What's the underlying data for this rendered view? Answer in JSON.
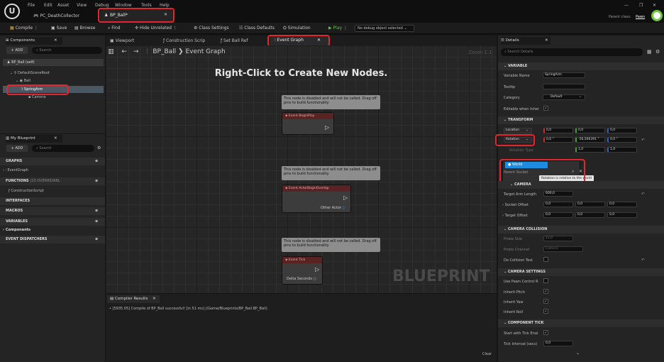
{
  "menu": [
    "File",
    "Edit",
    "Asset",
    "View",
    "Debug",
    "Window",
    "Tools",
    "Help"
  ],
  "project_name": "PC_DeathCollector",
  "doc_tab": "BP_Ball*",
  "parent_class_label": "Parent class:",
  "parent_class_value": "Pawn",
  "toolbar": {
    "compile": "Compile",
    "save": "Save",
    "browse": "Browse",
    "find": "Find",
    "hide_unrelated": "Hide Unrelated",
    "class_settings": "Class Settings",
    "class_defaults": "Class Defaults",
    "simulation": "Simulation",
    "play": "Play",
    "debug_object": "No debug object selected"
  },
  "components": {
    "title": "Components",
    "add": "+ ADD",
    "search_placeholder": "Search",
    "self": "BP_Ball (self)",
    "root": "DefaultSceneRoot",
    "ball": "Ball",
    "spring": "SpringArm",
    "camera": "Camera"
  },
  "my_blueprint": {
    "title": "My Blueprint",
    "add": "+ ADD",
    "search_placeholder": "Search",
    "graphs": "GRAPHS",
    "event_graph": "EventGraph",
    "functions": "FUNCTIONS",
    "functions_count": "(23 OVERRIDABL",
    "construction": "ConstructionScript",
    "interfaces": "INTERFACES",
    "macros": "MACROS",
    "variables": "VARIABLES",
    "components": "Components",
    "dispatchers": "EVENT DISPATCHERS"
  },
  "graph_tabs": {
    "viewport": "Viewport",
    "construction": "Construction Scrip",
    "set_ball_ref": "Set Ball Ref",
    "event_graph": "Event Graph"
  },
  "breadcrumb": {
    "bp": "BP_Ball",
    "graph": "Event Graph",
    "zoom": "Zoom 1:1"
  },
  "graph_hint": "Right-Click to Create New Nodes.",
  "disabled_note": "This node is disabled and will not be called. Drag off pins to build functionality",
  "nodes": {
    "begin_play": "Event BeginPlay",
    "overlap": "Event ActorBeginOverlap",
    "other_actor": "Other Actor",
    "tick": "Event Tick",
    "delta": "Delta Seconds"
  },
  "watermark": "BLUEPRINT",
  "compiler": {
    "title": "Compiler Results",
    "log": "• [5935.05] Compile of BP_Ball successful! [in 51 ms] (/Game/Blueprints/BP_Ball.BP_Ball)",
    "clear": "Clear"
  },
  "details": {
    "title": "Details",
    "search_placeholder": "Search Details",
    "variable_section": "VARIABLE",
    "var_name_label": "Variable Name",
    "var_name_value": "SpringArm",
    "tooltip_label": "Tooltip",
    "category_label": "Category",
    "category_value": "Default",
    "editable_label": "Editable when Inher",
    "transform_section": "TRANSFORM",
    "location": "Location",
    "loc": [
      "0,0",
      "0,0",
      "0,0"
    ],
    "rotation": "Rotation",
    "rot": [
      "0,0 °",
      "-56,566391 °",
      "0,0 °"
    ],
    "scale_label": "Rotation Type",
    "scale": [
      "1,0",
      "1,0"
    ],
    "world": "World",
    "tooltip": "Rotation is relative to the world",
    "parent_socket": "Parent Socket",
    "camera_section": "CAMERA",
    "target_arm": "Target Arm Length",
    "target_arm_value": "600,0",
    "socket_offset": "Socket Offset",
    "target_offset": "Target Offset",
    "offset_vals": [
      "0,0",
      "0,0",
      "0,0"
    ],
    "collision_section": "CAMERA COLLISION",
    "probe_size": "Probe Size",
    "probe_size_value": "12,0",
    "probe_channel": "Probe Channel",
    "probe_channel_value": "Camera",
    "do_collision": "Do Collision Test",
    "camera_settings": "CAMERA SETTINGS",
    "use_pawn": "Use Pawn Control R",
    "inherit_pitch": "Inherit Pitch",
    "inherit_yaw": "Inherit Yaw",
    "inherit_roll": "Inherit Roll",
    "tick_section": "COMPONENT TICK",
    "start_tick": "Start with Tick Enal",
    "tick_interval": "Tick Interval (secs)",
    "tick_interval_value": "0,0"
  }
}
